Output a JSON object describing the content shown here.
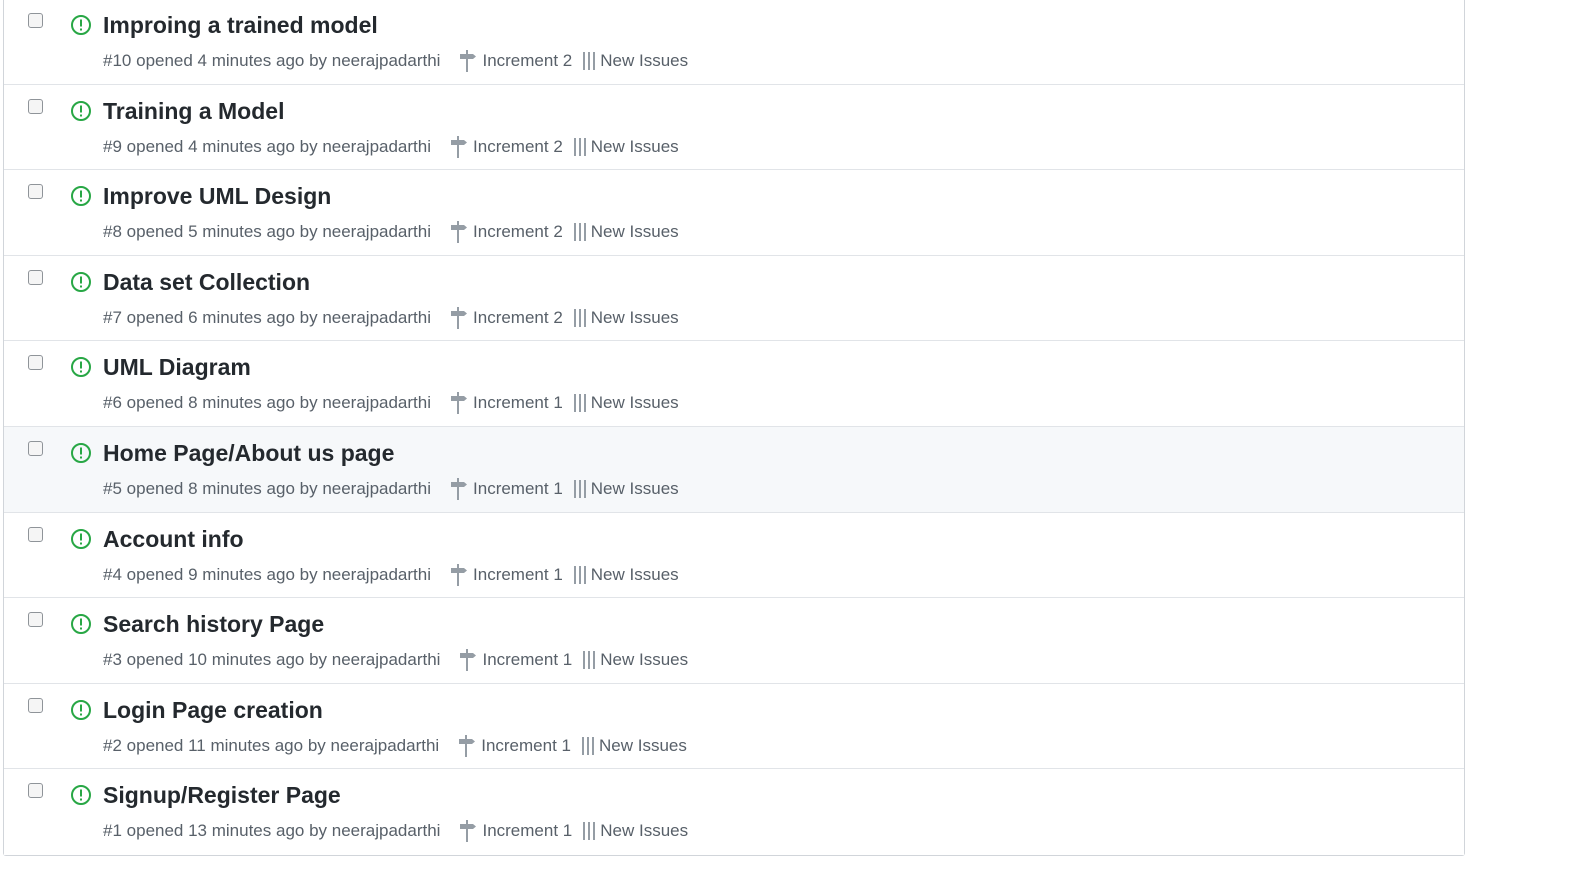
{
  "colors": {
    "open_icon": "#28a745",
    "title": "#24292e",
    "meta": "#586069",
    "hover_row": "#f6f8fa",
    "border": "#d1d5da"
  },
  "icons": {
    "status": "issue-opened-icon",
    "milestone": "milestone-icon",
    "project": "project-icon"
  },
  "issues": [
    {
      "title": "Improing a trained model",
      "number": "#10",
      "opened": "opened 4 minutes ago by",
      "author": "neerajpadarthi",
      "milestone": "Increment 2",
      "project": "New Issues"
    },
    {
      "title": "Training a Model",
      "number": "#9",
      "opened": "opened 4 minutes ago by",
      "author": "neerajpadarthi",
      "milestone": "Increment 2",
      "project": "New Issues"
    },
    {
      "title": "Improve UML Design",
      "number": "#8",
      "opened": "opened 5 minutes ago by",
      "author": "neerajpadarthi",
      "milestone": "Increment 2",
      "project": "New Issues"
    },
    {
      "title": "Data set Collection",
      "number": "#7",
      "opened": "opened 6 minutes ago by",
      "author": "neerajpadarthi",
      "milestone": "Increment 2",
      "project": "New Issues"
    },
    {
      "title": "UML Diagram",
      "number": "#6",
      "opened": "opened 8 minutes ago by",
      "author": "neerajpadarthi",
      "milestone": "Increment 1",
      "project": "New Issues"
    },
    {
      "title": "Home Page/About us page",
      "number": "#5",
      "opened": "opened 8 minutes ago by",
      "author": "neerajpadarthi",
      "milestone": "Increment 1",
      "project": "New Issues"
    },
    {
      "title": "Account info",
      "number": "#4",
      "opened": "opened 9 minutes ago by",
      "author": "neerajpadarthi",
      "milestone": "Increment 1",
      "project": "New Issues"
    },
    {
      "title": "Search history Page",
      "number": "#3",
      "opened": "opened 10 minutes ago by",
      "author": "neerajpadarthi",
      "milestone": "Increment 1",
      "project": "New Issues"
    },
    {
      "title": "Login Page creation",
      "number": "#2",
      "opened": "opened 11 minutes ago by",
      "author": "neerajpadarthi",
      "milestone": "Increment 1",
      "project": "New Issues"
    },
    {
      "title": "Signup/Register Page",
      "number": "#1",
      "opened": "opened 13 minutes ago by",
      "author": "neerajpadarthi",
      "milestone": "Increment 1",
      "project": "New Issues"
    }
  ]
}
